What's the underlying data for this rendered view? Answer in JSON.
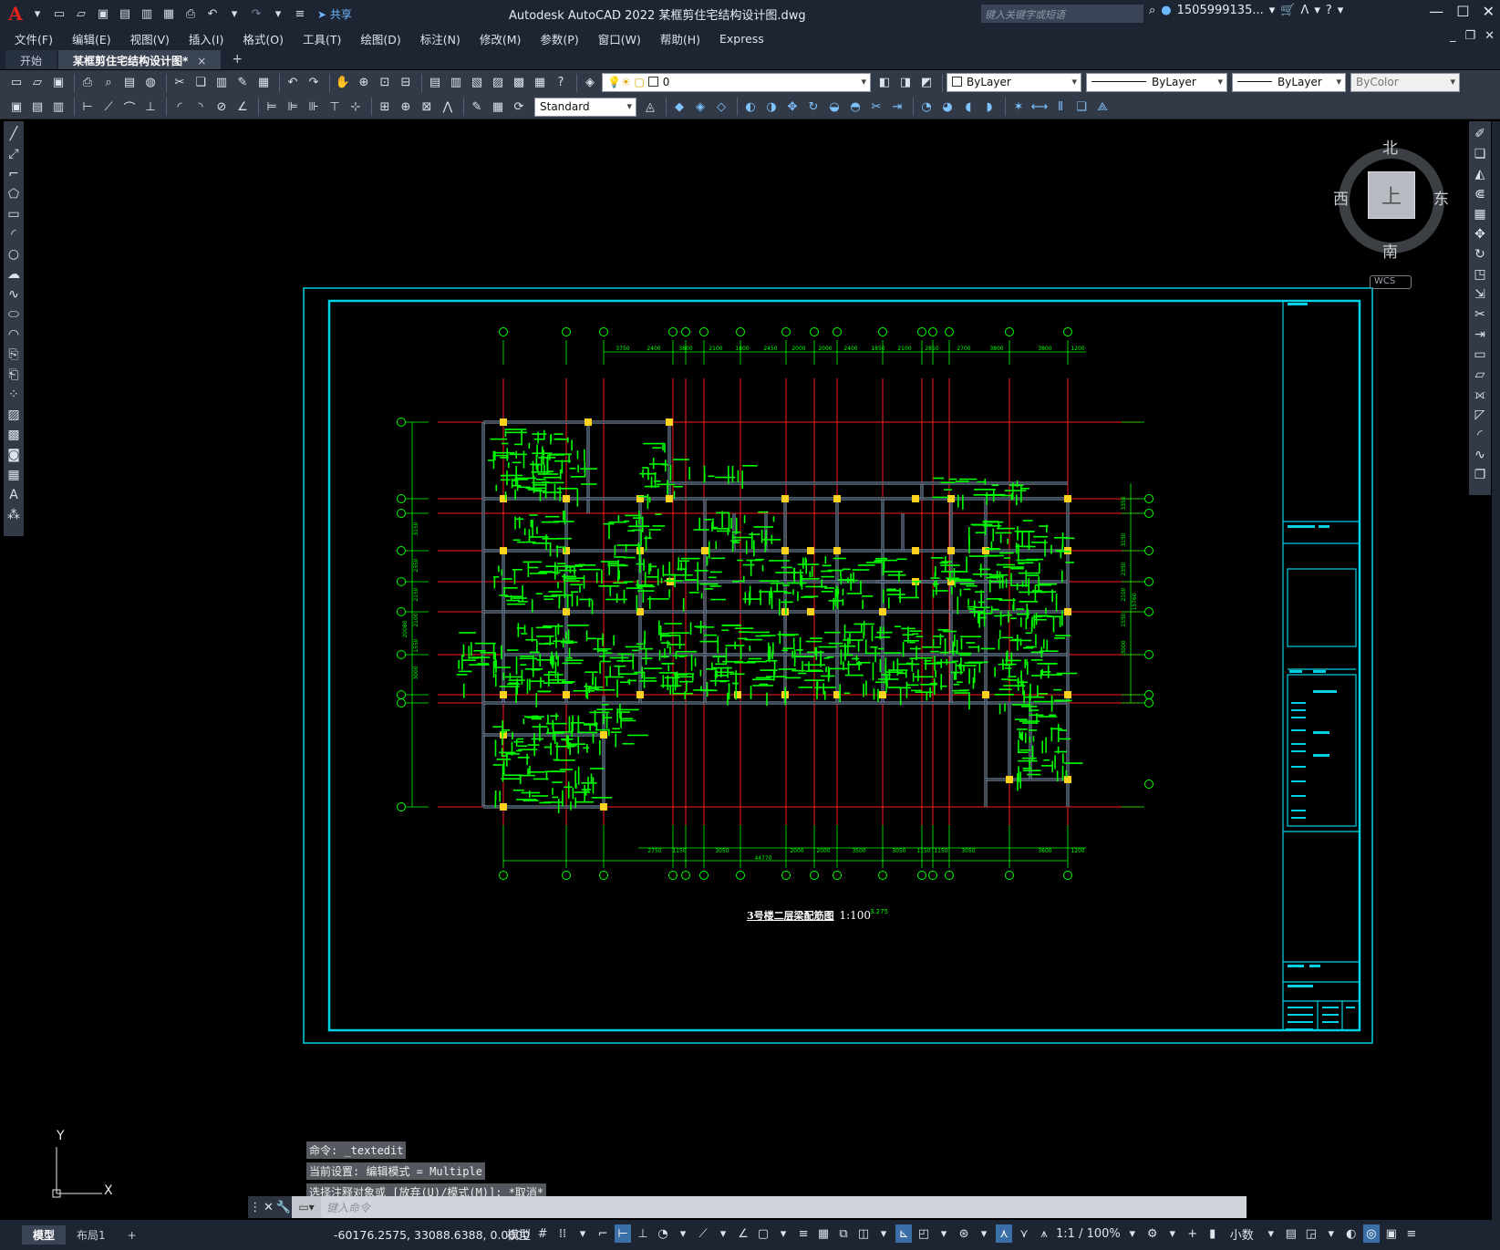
{
  "app": {
    "title": "Autodesk AutoCAD 2022    某框剪住宅结构设计图.dwg",
    "share_label": "共享",
    "search_placeholder": "键入关键字或短语",
    "user": "1505999135...",
    "logo": "A"
  },
  "menu": [
    "文件(F)",
    "编辑(E)",
    "视图(V)",
    "插入(I)",
    "格式(O)",
    "工具(T)",
    "绘图(D)",
    "标注(N)",
    "修改(M)",
    "参数(P)",
    "窗口(W)",
    "帮助(H)",
    "Express"
  ],
  "tabs": {
    "start": "开始",
    "doc": "某框剪住宅结构设计图*",
    "close": "×",
    "add": "+"
  },
  "toolbar": {
    "layer_value": "0",
    "color_value": "ByLayer",
    "linetype_value": "ByLayer",
    "lineweight_value": "ByLayer",
    "plotstyle_value": "ByColor",
    "textstyle_value": "Standard"
  },
  "viewcube": {
    "north": "北",
    "south": "南",
    "east": "东",
    "west": "西",
    "face": "上",
    "wcs": "WCS"
  },
  "drawing": {
    "title": "3号楼二层梁配筋图",
    "scale": "1:100",
    "level_mark": "3.275",
    "top_dims": [
      "3750",
      "2400",
      "3800",
      "2100",
      "1800",
      "2450",
      "2000",
      "2000",
      "2400",
      "1850",
      "2100",
      "2850",
      "2700",
      "3800",
      "3800",
      "1200"
    ],
    "bottom_dims": [
      "2750",
      "1150",
      "3050",
      "2000",
      "2000",
      "3500",
      "3050",
      "1150",
      "1150",
      "3050",
      "3600",
      "1200"
    ],
    "total_dim": "44770",
    "left_dims": [
      "3150",
      "2350",
      "2150",
      "2100",
      "1550",
      "3000"
    ],
    "left_total": "20080",
    "right_dims": [
      "3350",
      "3150",
      "2350",
      "2100",
      "1550",
      "3000"
    ],
    "right_total": "15760"
  },
  "ucs": {
    "y": "Y",
    "x": "X"
  },
  "command": {
    "history": [
      "命令: _textedit",
      "当前设置: 编辑模式 = Multiple",
      "选择注释对象或 [放弃(U)/模式(M)]: *取消*"
    ],
    "placeholder": "键入命令"
  },
  "status": {
    "model_tab": "模型",
    "layout_tab": "布局1",
    "add": "+",
    "coords": "-60176.2575, 33088.6388, 0.0000",
    "space": "模型",
    "scale": "1:1 / 100%",
    "units": "小数"
  },
  "colors": {
    "frame": "#00d2e6",
    "axis": "#ff1a1a",
    "grid": "#00ff00",
    "column": "#ffd21e",
    "beam": "#8aa0b8",
    "rebar": "#00ff00"
  }
}
